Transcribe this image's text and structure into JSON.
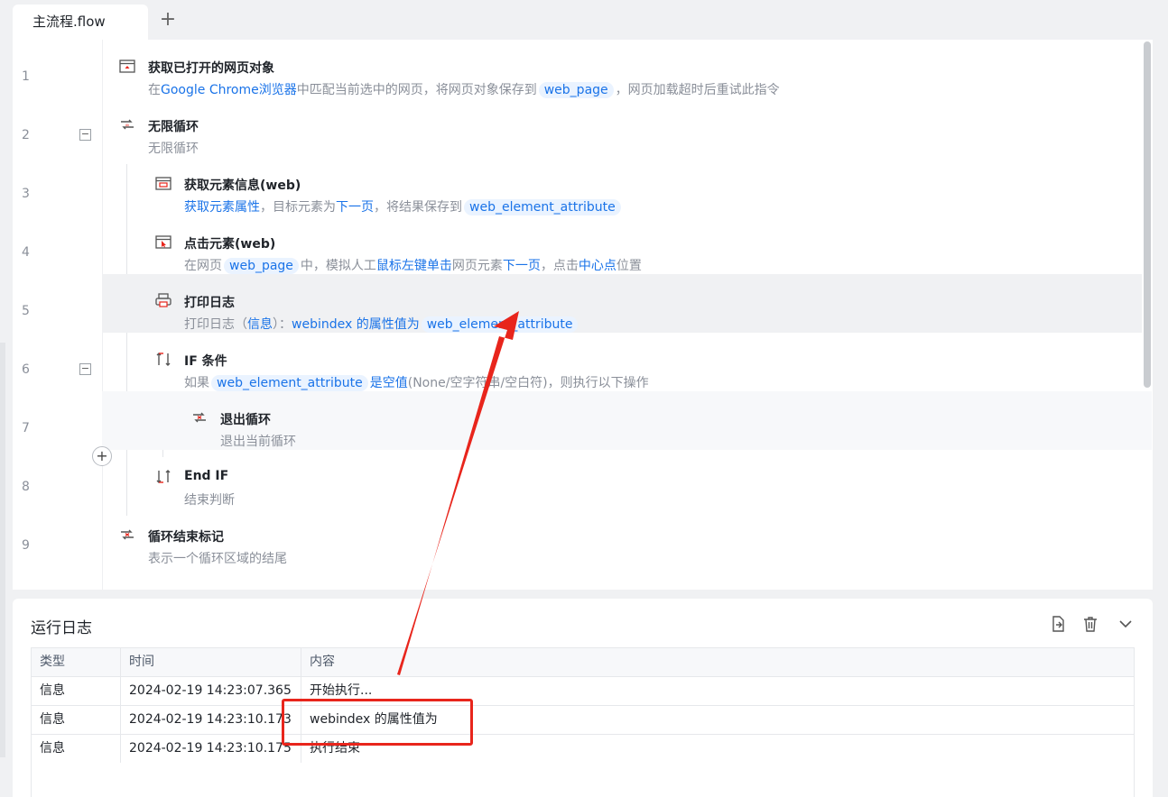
{
  "tabs": {
    "active": "主流程.flow",
    "add": "+"
  },
  "editor": {
    "rows": [
      {
        "no": "1",
        "title": "获取已打开的网页对象",
        "desc": [
          [
            "在",
            ""
          ],
          [
            "Google Chrome浏览器",
            "blue"
          ],
          [
            "中匹配当前选中的网页，将网页对象保存到",
            ""
          ],
          [
            "web_page",
            "chip"
          ],
          [
            "，网页加载超时后重试此指令",
            ""
          ]
        ]
      },
      {
        "no": "2",
        "fold": "−",
        "title": "无限循环",
        "desc": [
          [
            "无限循环",
            ""
          ]
        ]
      },
      {
        "no": "3",
        "title": "获取元素信息(web)",
        "desc": [
          [
            "获取元素属性",
            "blue"
          ],
          [
            "，目标元素为",
            ""
          ],
          [
            "下一页",
            "blue"
          ],
          [
            "，将结果保存到",
            ""
          ],
          [
            "web_element_attribute",
            "chip"
          ]
        ]
      },
      {
        "no": "4",
        "title": "点击元素(web)",
        "desc": [
          [
            "在网页",
            ""
          ],
          [
            "web_page",
            "chip"
          ],
          [
            "中，模拟人工",
            ""
          ],
          [
            "鼠标左键单击",
            "blue"
          ],
          [
            "网页元素",
            ""
          ],
          [
            "下一页",
            "blue"
          ],
          [
            "，点击",
            ""
          ],
          [
            "中心点",
            "blue"
          ],
          [
            "位置",
            ""
          ]
        ]
      },
      {
        "no": "5",
        "title": "打印日志",
        "desc": [
          [
            "打印日志（",
            ""
          ],
          [
            "信息",
            "blue"
          ],
          [
            "）：",
            ""
          ],
          [
            "webindex 的属性值为",
            "blue"
          ],
          [
            "web_element_attribute",
            "chip"
          ]
        ]
      },
      {
        "no": "6",
        "fold": "−",
        "title": "IF 条件",
        "desc": [
          [
            "如果",
            ""
          ],
          [
            "web_element_attribute",
            "chip"
          ],
          [
            "是空值",
            "blue"
          ],
          [
            "(None/空字符串/空白符)，则执行以下操作",
            ""
          ]
        ]
      },
      {
        "no": "7",
        "title": "退出循环",
        "desc": [
          [
            "退出当前循环",
            ""
          ]
        ]
      },
      {
        "no": "8",
        "title": "End IF",
        "desc": [
          [
            "结束判断",
            ""
          ]
        ]
      },
      {
        "no": "9",
        "title": "循环结束标记",
        "desc": [
          [
            "表示一个循环区域的结尾",
            ""
          ]
        ]
      }
    ],
    "add_button": "+"
  },
  "log": {
    "title": "运行日志",
    "columns": [
      "类型",
      "时间",
      "内容"
    ],
    "rows": [
      [
        "信息",
        "2024-02-19 14:23:07.365",
        "开始执行..."
      ],
      [
        "信息",
        "2024-02-19 14:23:10.173",
        "webindex 的属性值为"
      ],
      [
        "信息",
        "2024-02-19 14:23:10.175",
        "执行结束"
      ]
    ]
  },
  "colors": {
    "accent": "#1a73e8",
    "annotation": "#e8251c",
    "highlight": "#f0f1f3"
  }
}
